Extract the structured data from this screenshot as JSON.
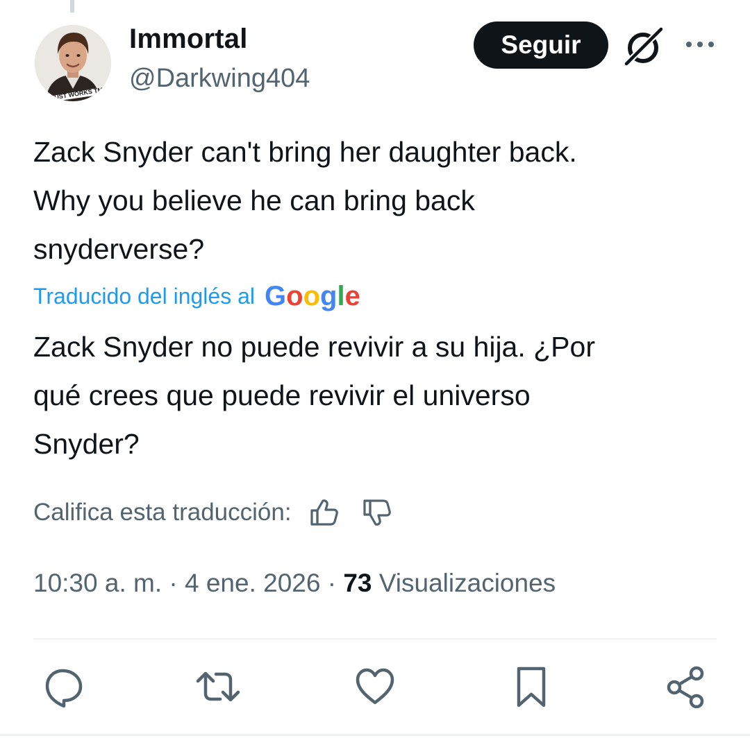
{
  "tweet": {
    "author_name": "Immortal",
    "author_handle": "@Darkwing404",
    "avatar_caption": "IT JUST WORKS TM",
    "follow_label": "Seguir",
    "text_lines": [
      "Zack Snyder can't bring her daughter back.",
      "Why you believe he can bring back",
      "snyderverse?"
    ],
    "translated_label": "Traducido del inglés al",
    "google_logo_text": "Google",
    "translation_lines": [
      "Zack Snyder no puede revivir a su hija. ¿Por",
      "qué crees que puede revivir el universo",
      "Snyder?"
    ],
    "rate_label": "Califica esta traducción:",
    "time": "10:30 a. m.",
    "separator": "·",
    "date": "4 ene. 2026",
    "views_count": "73",
    "views_label": "Visualizaciones"
  },
  "icons": [
    "grok-icon",
    "more-icon",
    "thumbs-up-icon",
    "thumbs-down-icon",
    "reply-icon",
    "retweet-icon",
    "like-icon",
    "bookmark-icon",
    "share-icon"
  ],
  "colors": {
    "text": "#0f1419",
    "secondary": "#536471",
    "link_blue": "#1d9bf0",
    "button_bg": "#0f1419",
    "divider": "#eff3f4",
    "google_blue": "#4285F4",
    "google_red": "#EA4335",
    "google_yellow": "#FBBC05",
    "google_green": "#34A853"
  }
}
